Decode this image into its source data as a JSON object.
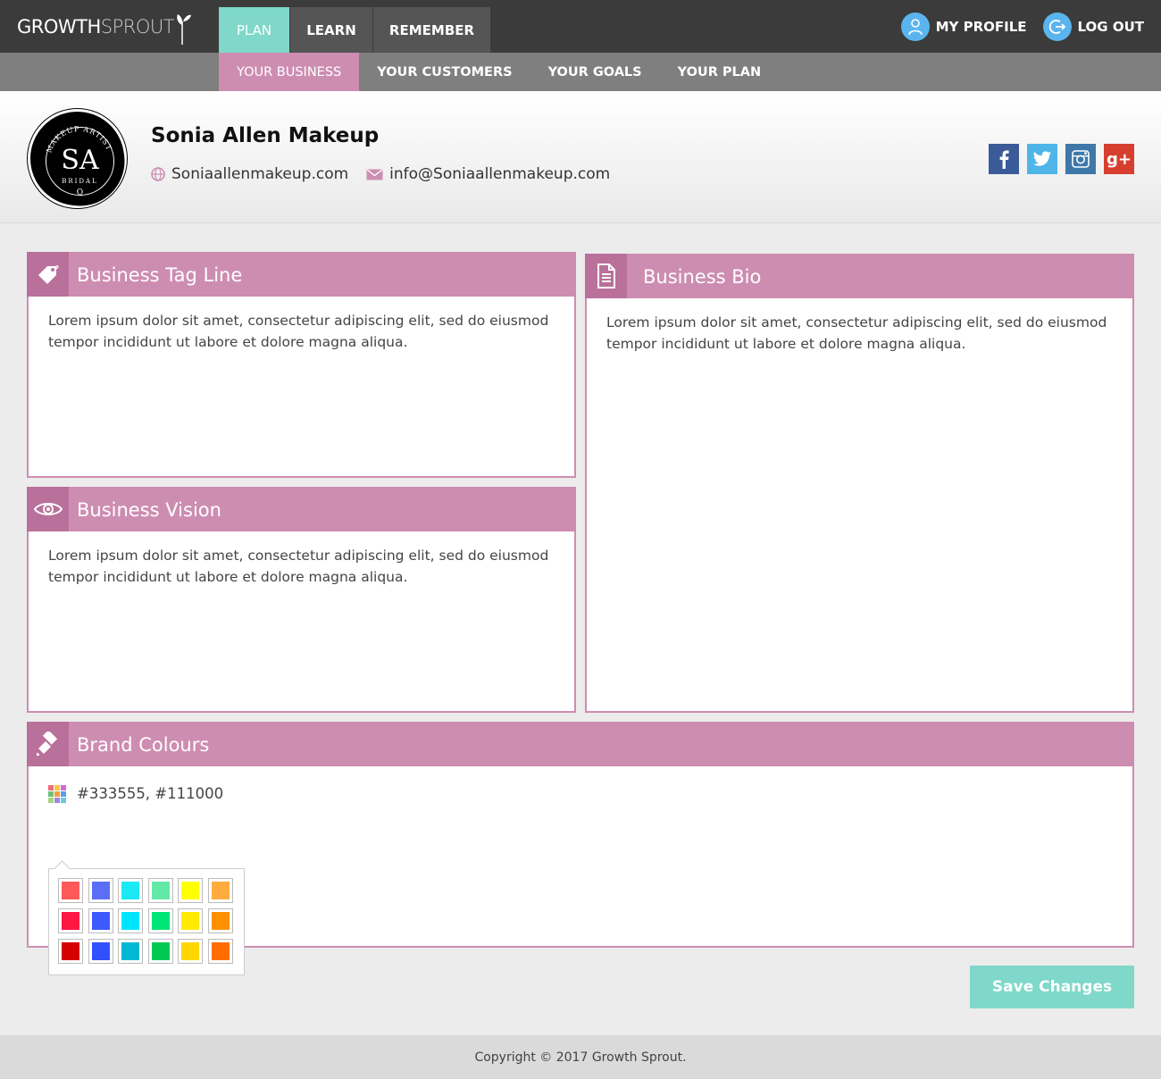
{
  "app": {
    "logo_part1": "GROWTH",
    "logo_part2": "SPROUT"
  },
  "nav": {
    "main_tabs": [
      {
        "label": "PLAN",
        "active": true
      },
      {
        "label": "LEARN",
        "active": false
      },
      {
        "label": "REMEMBER",
        "active": false
      }
    ],
    "sub_tabs": [
      {
        "label": "YOUR BUSINESS",
        "active": true
      },
      {
        "label": "YOUR CUSTOMERS",
        "active": false
      },
      {
        "label": "YOUR GOALS",
        "active": false
      },
      {
        "label": "YOUR PLAN",
        "active": false
      }
    ],
    "profile_label": "MY PROFILE",
    "logout_label": "LOG OUT"
  },
  "profile": {
    "business_name": "Sonia Allen Makeup",
    "website": "Soniaallenmakeup.com",
    "email": "info@Soniaallenmakeup.com",
    "logo_text": {
      "ring_top": "MAKEUP ARTIST",
      "monogram": "SA",
      "ring_bottom": "BRIDAL",
      "small": "Q"
    },
    "socials": [
      "facebook-icon",
      "twitter-icon",
      "instagram-icon",
      "google-plus-icon"
    ],
    "gplus_label": "g+"
  },
  "cards": {
    "tagline": {
      "title": "Business Tag Line",
      "text": "Lorem ipsum dolor sit amet, consectetur adipiscing elit, sed do eiusmod tempor incididunt ut labore et dolore magna aliqua."
    },
    "vision": {
      "title": "Business Vision",
      "text": "Lorem ipsum dolor sit amet, consectetur adipiscing elit, sed do eiusmod tempor incididunt ut labore et dolore magna aliqua."
    },
    "bio": {
      "title": "Business Bio",
      "text": "Lorem ipsum dolor sit amet, consectetur adipiscing elit, sed do eiusmod tempor incididunt ut labore et dolore magna aliqua."
    },
    "brand": {
      "title": "Brand Colours",
      "value": "#333555,  #111000",
      "swatches": [
        [
          "#ff5a5a",
          "#5c6ef5",
          "#1de9f5",
          "#63e8a7",
          "#ffff00",
          "#ffab40"
        ],
        [
          "#ff1744",
          "#3d5afe",
          "#00e5ff",
          "#00e676",
          "#ffea00",
          "#ff9100"
        ],
        [
          "#d50000",
          "#304ffe",
          "#00b8d4",
          "#00c853",
          "#ffd600",
          "#ff6d00"
        ]
      ]
    }
  },
  "actions": {
    "save_label": "Save Changes"
  },
  "footer": {
    "copyright": "Copyright © 2017 Growth Sprout."
  },
  "colors": {
    "accent_teal": "#7fd8c9",
    "accent_pink": "#cd8db1",
    "nav_dark": "#3b3b3b",
    "nav_grey": "#7f7f7f"
  }
}
